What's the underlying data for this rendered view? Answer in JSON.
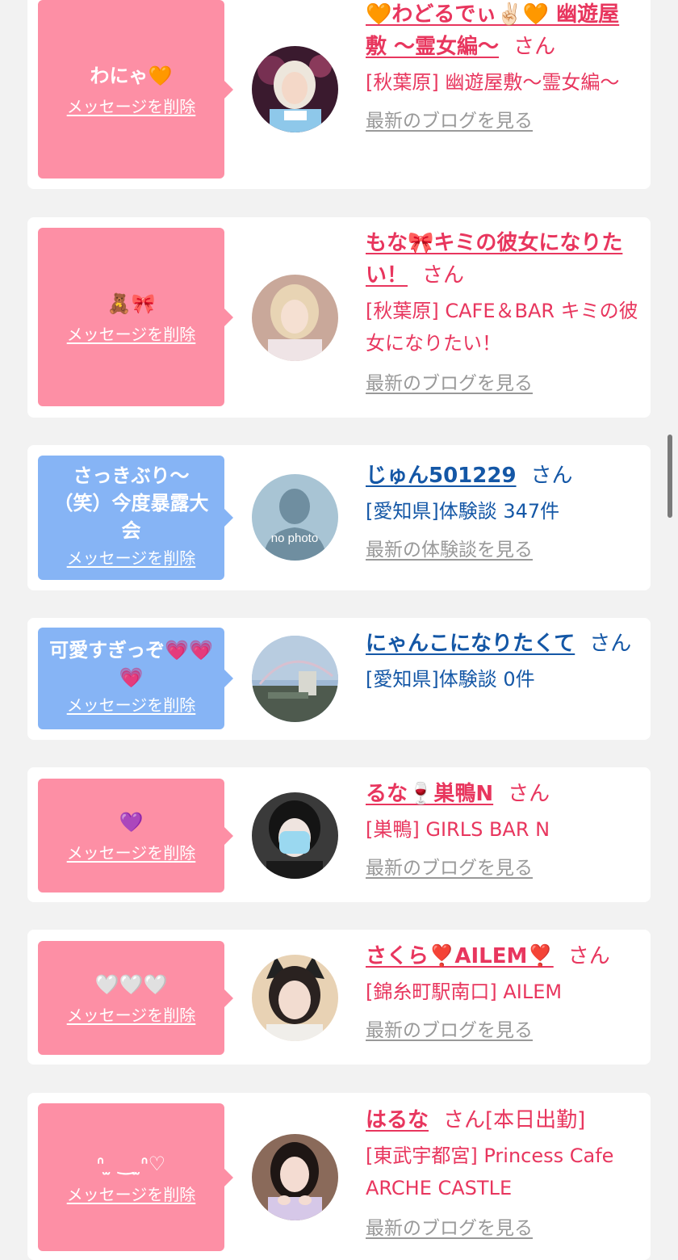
{
  "items": [
    {
      "message": "わにゃ🧡",
      "delete_label": "メッセージを削除",
      "name": "🧡わどるでぃ✌🏻🧡 幽遊屋敷 〜霊女編〜",
      "honorific": "さん",
      "status": "",
      "shop": "[秋葉原] 幽遊屋敷〜霊女編〜",
      "blog_label": "最新のブログを見る",
      "avatar_icon": "cosplay-girl-photo"
    },
    {
      "message": "🧸🎀",
      "delete_label": "メッセージを削除",
      "name": "もな🎀キミの彼女になりたい！",
      "honorific": "さん",
      "status": "",
      "shop": "[秋葉原] CAFE＆BAR キミの彼女になりたい！",
      "blog_label": "最新のブログを見る",
      "avatar_icon": "blonde-girl-photo"
    },
    {
      "message": "さっきぶり〜（笑）今度暴露大会",
      "delete_label": "メッセージを削除",
      "name": "じゅん501229",
      "honorific": "さん",
      "status": "",
      "shop": "[愛知県]体験談 347件",
      "blog_label": "最新の体験談を見る",
      "avatar_icon": "no-photo-silhouette",
      "avatar_text": "no photo"
    },
    {
      "message": "可愛すぎっぞ💗💗💗",
      "delete_label": "メッセージを削除",
      "name": "にゃんこになりたくて",
      "honorific": "さん",
      "status": "",
      "shop": "[愛知県]体験談 0件",
      "blog_label": "",
      "avatar_icon": "sky-rainbow-photo"
    },
    {
      "message": "💜",
      "delete_label": "メッセージを削除",
      "name": "るな🍷巣鴨N",
      "honorific": "さん",
      "status": "",
      "shop": "[巣鴨] GIRLS BAR N",
      "blog_label": "最新のブログを見る",
      "avatar_icon": "masked-girl-photo"
    },
    {
      "message": "🤍🤍🤍",
      "delete_label": "メッセージを削除",
      "name": "さくら❣️AILEM❣️",
      "honorific": "さん",
      "status": "",
      "shop": "[錦糸町駅南口] AILEM",
      "blog_label": "最新のブログを見る",
      "avatar_icon": "cat-ears-girl-photo"
    },
    {
      "message": "ᐢ ̫ ‿ ̫ᐢ♡",
      "delete_label": "メッセージを削除",
      "name": "はるな",
      "honorific": "さん",
      "status": "[本日出勤]",
      "shop": "[東武宇都宮] Princess Cafe ARCHE CASTLE",
      "blog_label": "最新のブログを見る",
      "avatar_icon": "dark-hair-girl-photo"
    }
  ],
  "colors": {
    "pink_bubble": "#fd8fa5",
    "blue_bubble": "#86b4f5",
    "pink_text": "#e8365e",
    "blue_text": "#1457a6"
  }
}
